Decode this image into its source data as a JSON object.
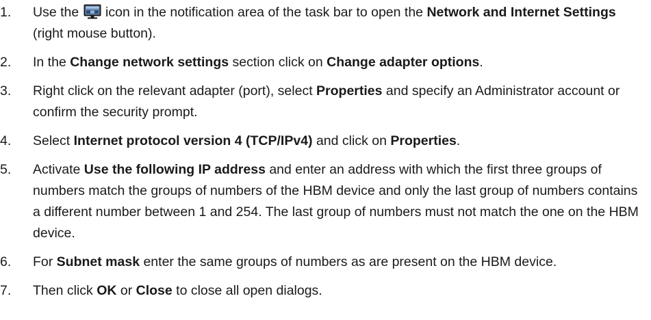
{
  "steps": [
    {
      "num": "1.",
      "before_icon": "Use the ",
      "icon": "network-icon",
      "parts": [
        {
          "t": " icon in the notification area of the task bar to open the ",
          "b": false
        },
        {
          "t": "Network and Internet Settings",
          "b": true
        },
        {
          "t": " (right mouse button).",
          "b": false
        }
      ]
    },
    {
      "num": "2.",
      "parts": [
        {
          "t": "In the ",
          "b": false
        },
        {
          "t": "Change network settings",
          "b": true
        },
        {
          "t": " section click on ",
          "b": false
        },
        {
          "t": "Change adapter options",
          "b": true
        },
        {
          "t": ".",
          "b": false
        }
      ]
    },
    {
      "num": "3.",
      "parts": [
        {
          "t": "Right click on the relevant adapter (port), select ",
          "b": false
        },
        {
          "t": "Properties",
          "b": true
        },
        {
          "t": " and specify an Adminis­trator account or confirm the security prompt.",
          "b": false
        }
      ]
    },
    {
      "num": "4.",
      "parts": [
        {
          "t": "Select ",
          "b": false
        },
        {
          "t": "Internet protocol version 4 (TCP/IPv4)",
          "b": true
        },
        {
          "t": " and click on ",
          "b": false
        },
        {
          "t": "Properties",
          "b": true
        },
        {
          "t": ".",
          "b": false
        }
      ]
    },
    {
      "num": "5.",
      "parts": [
        {
          "t": "Activate ",
          "b": false
        },
        {
          "t": "Use the following IP address",
          "b": true
        },
        {
          "t": " and enter an address with which the first three groups of numbers match the groups of numbers of the HBM device and only the last group of numbers contains a different number between 1 and 254. The last group of numbers must not match the one on the HBM device.",
          "b": false
        }
      ]
    },
    {
      "num": "6.",
      "parts": [
        {
          "t": "For ",
          "b": false
        },
        {
          "t": "Subnet mask",
          "b": true
        },
        {
          "t": " enter the same groups of numbers as are present on the HBM device.",
          "b": false
        }
      ]
    },
    {
      "num": "7.",
      "parts": [
        {
          "t": "Then click ",
          "b": false
        },
        {
          "t": "OK",
          "b": true
        },
        {
          "t": " or ",
          "b": false
        },
        {
          "t": "Close",
          "b": true
        },
        {
          "t": " to close all open dialogs.",
          "b": false
        }
      ]
    }
  ]
}
